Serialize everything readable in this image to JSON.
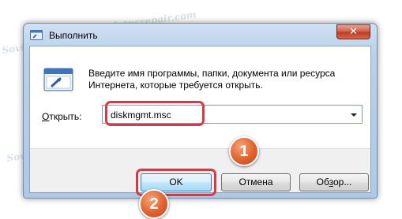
{
  "window": {
    "title": "Выполнить",
    "close_symbol": "✕",
    "icons": {
      "app": "run-app-icon",
      "run": "run-dialog-icon",
      "close": "close-icon",
      "dropdown": "chevron-down-icon"
    }
  },
  "prompt": {
    "text": "Введите имя программы, папки, документа или ресурса Интернета, которые требуется открыть."
  },
  "open_field": {
    "label_accel": "О",
    "label_rest": "ткрыть:",
    "value": "diskmgmt.msc"
  },
  "buttons": {
    "ok": "OK",
    "cancel": "Отмена",
    "browse_pre": "Об",
    "browse_accel": "з",
    "browse_post": "ор..."
  },
  "annotations": {
    "step1": "1",
    "step2": "2",
    "highlight_color": "#d23b4a",
    "badge_color": "#e0622e"
  },
  "watermark": {
    "text": "Sovietpcrepair.com"
  }
}
